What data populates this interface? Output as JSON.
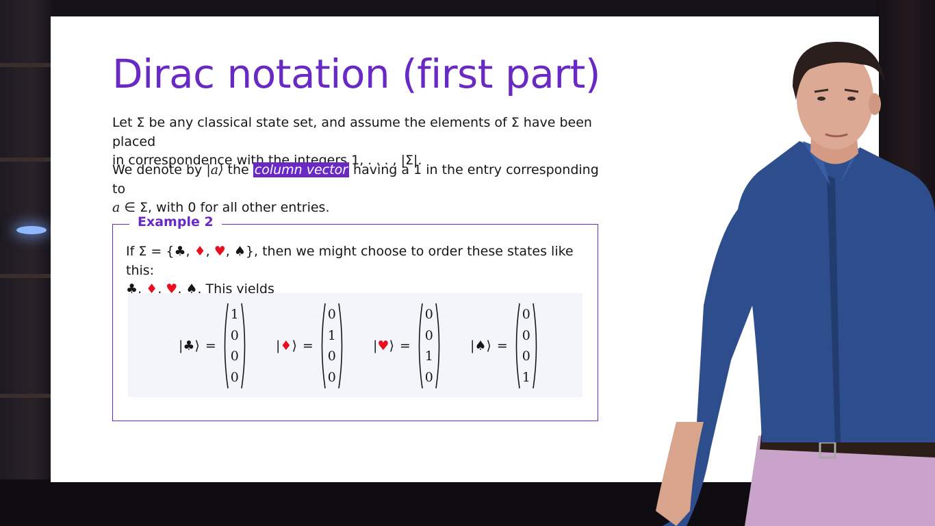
{
  "slide": {
    "title": "Dirac notation (first part)",
    "p1_a": "Let Σ be any classical state set, and assume the elements of Σ have been placed",
    "p1_b": "in correspondence with the integers 1, . . . , |Σ|.",
    "p2_a": "We denote by ",
    "p2_ket": "|a⟩",
    "p2_b": " the ",
    "p2_highlight": "column vector",
    "p2_c": " having a 1 in the entry corresponding to",
    "p2_d_var": "a",
    "p2_d": " ∈ Σ, with 0 for all other entries."
  },
  "example": {
    "label": "Example 2",
    "text_a": "If Σ = {",
    "text_b": "}, then we might choose to order these states like this:",
    "text_c": ". This yields",
    "sep": ", ",
    "suits": [
      "♣",
      "♦",
      "♥",
      "♠"
    ],
    "equals": "=",
    "vectors": [
      {
        "ket": "|♣⟩",
        "values": [
          "1",
          "0",
          "0",
          "0"
        ]
      },
      {
        "ket": "|♦⟩",
        "values": [
          "0",
          "1",
          "0",
          "0"
        ]
      },
      {
        "ket": "|♥⟩",
        "values": [
          "0",
          "0",
          "1",
          "0"
        ]
      },
      {
        "ket": "|♠⟩",
        "values": [
          "0",
          "0",
          "0",
          "1"
        ]
      }
    ]
  },
  "colors": {
    "accent": "#6929c4",
    "red_suit": "#e8101f",
    "black_suit": "#161616",
    "vector_box": "#f3f5fb"
  }
}
